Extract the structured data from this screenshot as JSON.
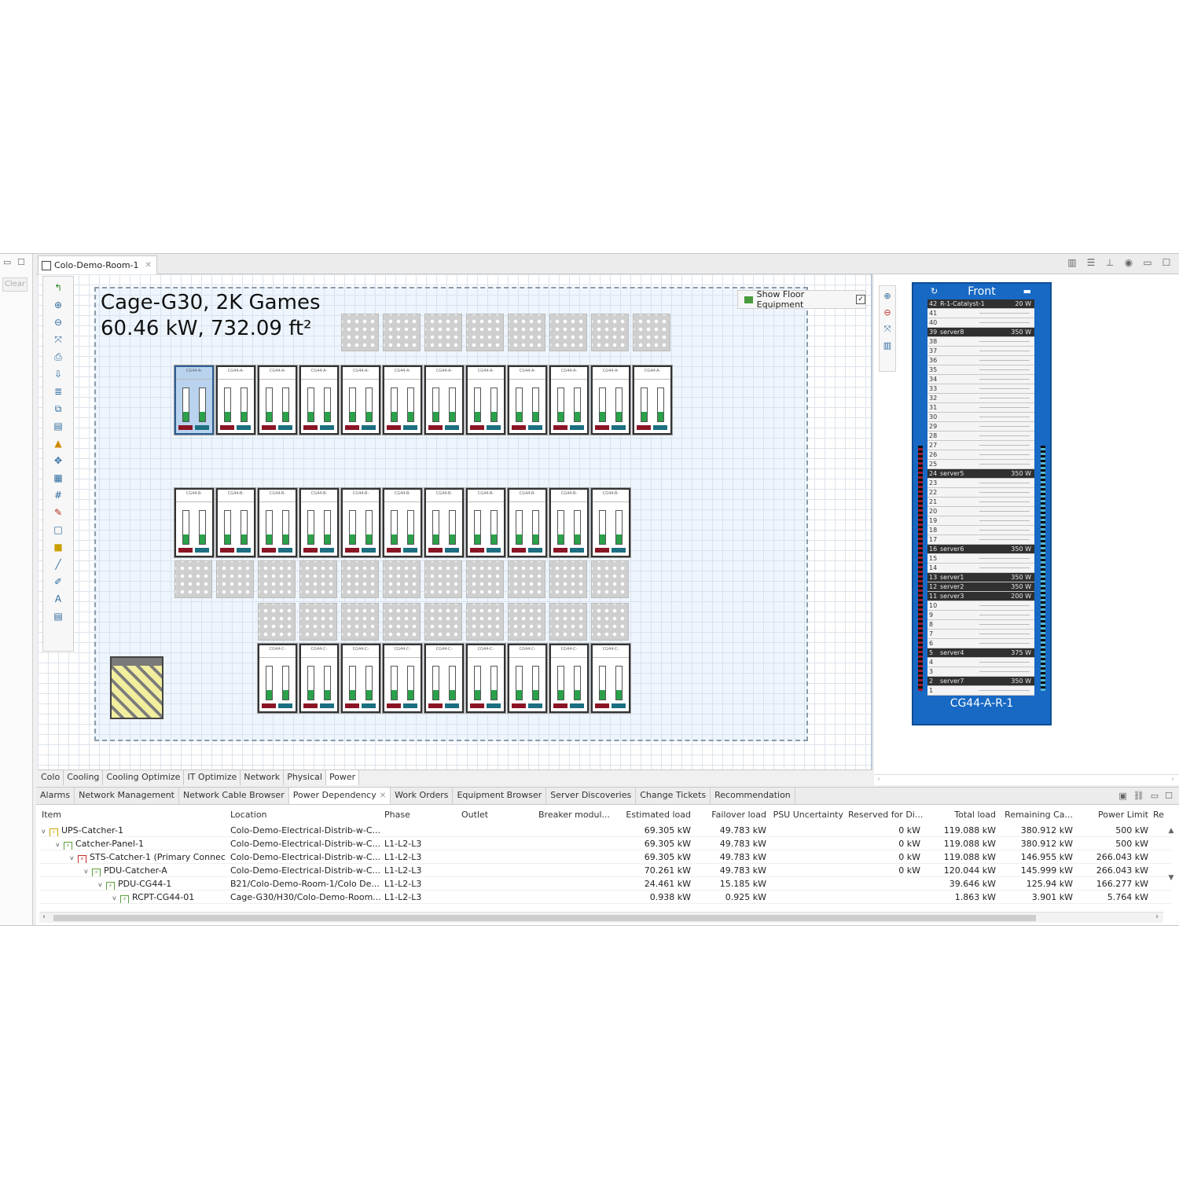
{
  "editor_tab": {
    "title": "Colo-Demo-Room-1"
  },
  "left": {
    "clear_label": "Clear"
  },
  "cage": {
    "title": "Cage-G30,  2K Games",
    "subtitle": "60.46 kW, 732.09 ft²"
  },
  "show_floor": {
    "label": "Show Floor Equipment",
    "checked": true
  },
  "rack_rows": [
    {
      "caption": "CG44-A-",
      "count": 12
    },
    {
      "caption": "CG44-B-",
      "count": 11
    },
    {
      "caption": "CG44-C-",
      "count": 9
    }
  ],
  "canvas_tabs": [
    "Colo",
    "Cooling",
    "Cooling Optimize",
    "IT Optimize",
    "Network",
    "Physical",
    "Power"
  ],
  "active_canvas_tab": "Power",
  "rack_view": {
    "face": "Front",
    "name": "CG44-A-R-1",
    "units": [
      {
        "u": "42",
        "name": "R-1-Catalyst-1",
        "power": "20 W"
      },
      {
        "u": "41"
      },
      {
        "u": "40"
      },
      {
        "u": "39",
        "name": "server8",
        "power": "350 W"
      },
      {
        "u": "38"
      },
      {
        "u": "37"
      },
      {
        "u": "36"
      },
      {
        "u": "35"
      },
      {
        "u": "34"
      },
      {
        "u": "33"
      },
      {
        "u": "32"
      },
      {
        "u": "31"
      },
      {
        "u": "30"
      },
      {
        "u": "29"
      },
      {
        "u": "28"
      },
      {
        "u": "27"
      },
      {
        "u": "26"
      },
      {
        "u": "25"
      },
      {
        "u": "24",
        "name": "server5",
        "power": "350 W"
      },
      {
        "u": "23"
      },
      {
        "u": "22"
      },
      {
        "u": "21"
      },
      {
        "u": "20"
      },
      {
        "u": "19"
      },
      {
        "u": "18"
      },
      {
        "u": "17"
      },
      {
        "u": "16",
        "name": "server6",
        "power": "350 W"
      },
      {
        "u": "15"
      },
      {
        "u": "14"
      },
      {
        "u": "13",
        "name": "server1",
        "power": "350 W"
      },
      {
        "u": "12",
        "name": "server2",
        "power": "350 W"
      },
      {
        "u": "11",
        "name": "server3",
        "power": "200 W"
      },
      {
        "u": "10"
      },
      {
        "u": "9"
      },
      {
        "u": "8"
      },
      {
        "u": "7"
      },
      {
        "u": "6"
      },
      {
        "u": "5",
        "name": "server4",
        "power": "375 W"
      },
      {
        "u": "4"
      },
      {
        "u": "3"
      },
      {
        "u": "2",
        "name": "server7",
        "power": "350 W"
      },
      {
        "u": "1"
      }
    ]
  },
  "bottom_tabs": [
    "Alarms",
    "Network Management",
    "Network Cable Browser",
    "Power Dependency",
    "Work Orders",
    "Equipment Browser",
    "Server Discoveries",
    "Change Tickets",
    "Recommendation"
  ],
  "active_bottom_tab": "Power Dependency",
  "table": {
    "columns": [
      "Item",
      "Location",
      "Phase",
      "Outlet",
      "Breaker modul...",
      "Estimated load",
      "Failover load",
      "PSU Uncertainty",
      "Reserved for Di...",
      "Total load",
      "Remaining Ca...",
      "Power Limit",
      "Re"
    ],
    "rows": [
      {
        "level": 0,
        "icon": "o",
        "item": "UPS-Catcher-1",
        "location": "Colo-Demo-Electrical-Distrib-w-C...",
        "phase": "",
        "outlet": "",
        "breaker": "",
        "est": "69.305 kW",
        "fail": "49.783 kW",
        "psu": "",
        "reserved": "0 kW",
        "total": "119.088 kW",
        "remaining": "380.912 kW",
        "limit": "500 kW"
      },
      {
        "level": 1,
        "icon": "g",
        "item": "Catcher-Panel-1",
        "location": "Colo-Demo-Electrical-Distrib-w-C...",
        "phase": "L1-L2-L3",
        "outlet": "",
        "breaker": "",
        "est": "69.305 kW",
        "fail": "49.783 kW",
        "psu": "",
        "reserved": "0 kW",
        "total": "119.088 kW",
        "remaining": "380.912 kW",
        "limit": "500 kW"
      },
      {
        "level": 2,
        "icon": "r",
        "item": "STS-Catcher-1 (Primary Connec",
        "location": "Colo-Demo-Electrical-Distrib-w-C...",
        "phase": "L1-L2-L3",
        "outlet": "",
        "breaker": "",
        "est": "69.305 kW",
        "fail": "49.783 kW",
        "psu": "",
        "reserved": "0 kW",
        "total": "119.088 kW",
        "remaining": "146.955 kW",
        "limit": "266.043 kW"
      },
      {
        "level": 3,
        "icon": "g",
        "item": "PDU-Catcher-A",
        "location": "Colo-Demo-Electrical-Distrib-w-C...",
        "phase": "L1-L2-L3",
        "outlet": "",
        "breaker": "",
        "est": "70.261 kW",
        "fail": "49.783 kW",
        "psu": "",
        "reserved": "0 kW",
        "total": "120.044 kW",
        "remaining": "145.999 kW",
        "limit": "266.043 kW"
      },
      {
        "level": 4,
        "icon": "g",
        "item": "PDU-CG44-1",
        "location": "B21/Colo-Demo-Room-1/Colo De...",
        "phase": "L1-L2-L3",
        "outlet": "",
        "breaker": "",
        "est": "24.461 kW",
        "fail": "15.185 kW",
        "psu": "",
        "reserved": "",
        "total": "39.646 kW",
        "remaining": "125.94 kW",
        "limit": "166.277 kW"
      },
      {
        "level": 5,
        "icon": "g",
        "item": "RCPT-CG44-01",
        "location": "Cage-G30/H30/Colo-Demo-Room...",
        "phase": "L1-L2-L3",
        "outlet": "",
        "breaker": "",
        "est": "0.938 kW",
        "fail": "0.925 kW",
        "psu": "",
        "reserved": "",
        "total": "1.863 kW",
        "remaining": "3.901 kW",
        "limit": "5.764 kW"
      }
    ]
  }
}
